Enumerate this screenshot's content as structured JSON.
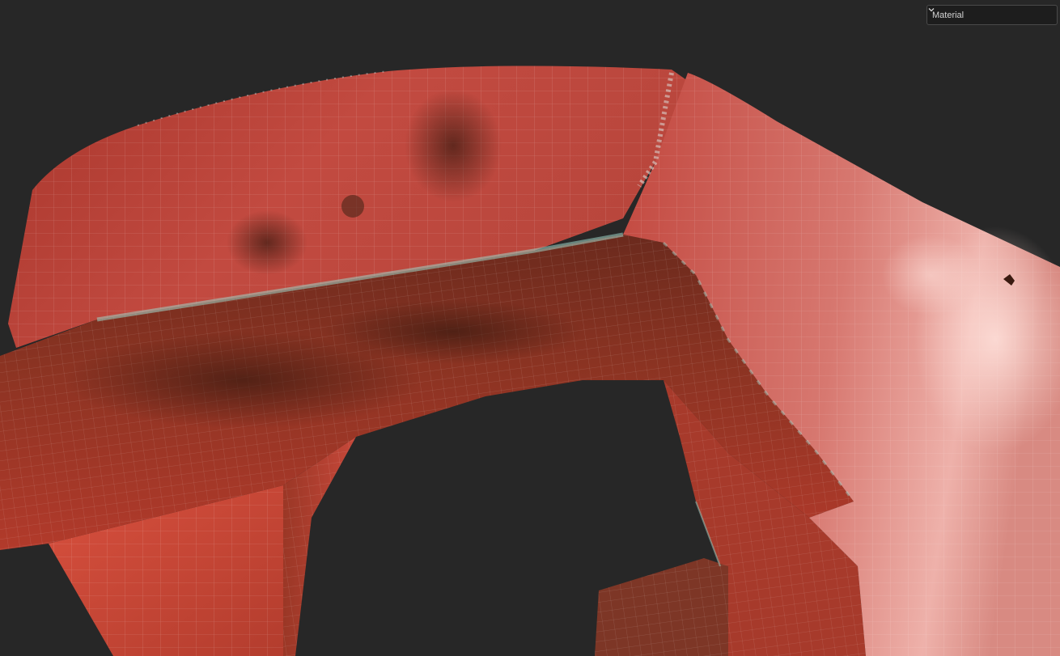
{
  "viewport": {
    "background": "#272727",
    "shading_mode": {
      "selected": "Material"
    }
  },
  "icons": {
    "dropdown_chevron": "chevron-down-icon"
  },
  "colors": {
    "paint_red": "#c2473e",
    "paint_highlight": "#e9a29b",
    "rust_dark": "#5a2a1a",
    "edge_teal": "#9fd3c7",
    "wireframe": "#ffffff"
  }
}
